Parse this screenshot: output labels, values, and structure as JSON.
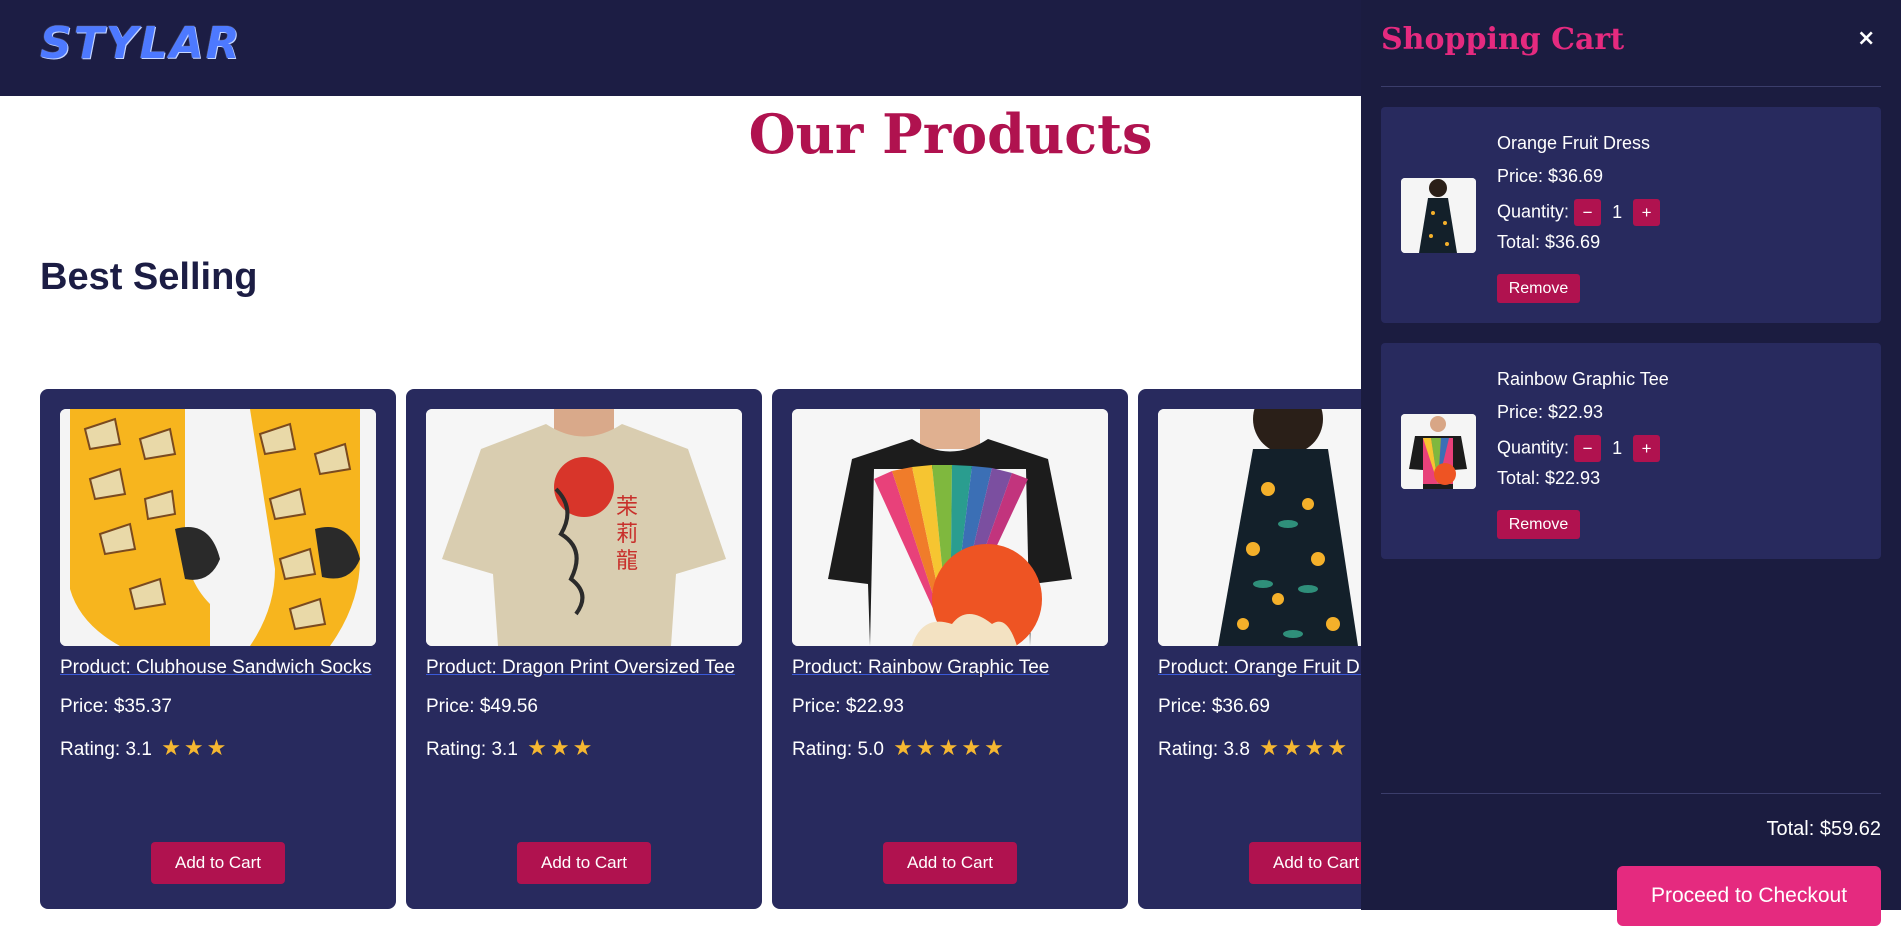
{
  "header": {
    "logo": "STYLAR"
  },
  "main": {
    "page_title": "Our Products",
    "section_title": "Best Selling",
    "products": [
      {
        "name": "Product: Clubhouse Sandwich Socks",
        "price": "Price: $35.37",
        "rating": "Rating: 3.1",
        "stars": "★★★",
        "button": "Add to Cart",
        "image_icon": "socks-image"
      },
      {
        "name": "Product: Dragon Print Oversized Tee",
        "price": "Price: $49.56",
        "rating": "Rating: 3.1",
        "stars": "★★★",
        "button": "Add to Cart",
        "image_icon": "tee-image"
      },
      {
        "name": "Product: Rainbow Graphic Tee",
        "price": "Price: $22.93",
        "rating": "Rating: 5.0",
        "stars": "★★★★★",
        "button": "Add to Cart",
        "image_icon": "rainbow-tee-image"
      },
      {
        "name": "Product: Orange Fruit Dress",
        "price": "Price: $36.69",
        "rating": "Rating: 3.8",
        "stars": "★★★★",
        "button": "Add to Cart",
        "image_icon": "dress-image"
      }
    ]
  },
  "cart": {
    "title": "Shopping Cart",
    "close_icon": "×",
    "quantity_label": "Quantity:",
    "minus": "−",
    "plus": "+",
    "remove_label": "Remove",
    "items": [
      {
        "name": "Orange Fruit Dress",
        "price": "Price: $36.69",
        "quantity": "1",
        "total": "Total: $36.69"
      },
      {
        "name": "Rainbow Graphic Tee",
        "price": "Price: $22.93",
        "quantity": "1",
        "total": "Total: $22.93"
      }
    ],
    "grand_total": "Total: $59.62",
    "checkout_label": "Proceed to Checkout"
  },
  "colors": {
    "header_bg": "#1c1d44",
    "card_bg": "#282a5e",
    "accent": "#b0124f",
    "cart_title": "#e52a7f",
    "star": "#f5b731"
  }
}
